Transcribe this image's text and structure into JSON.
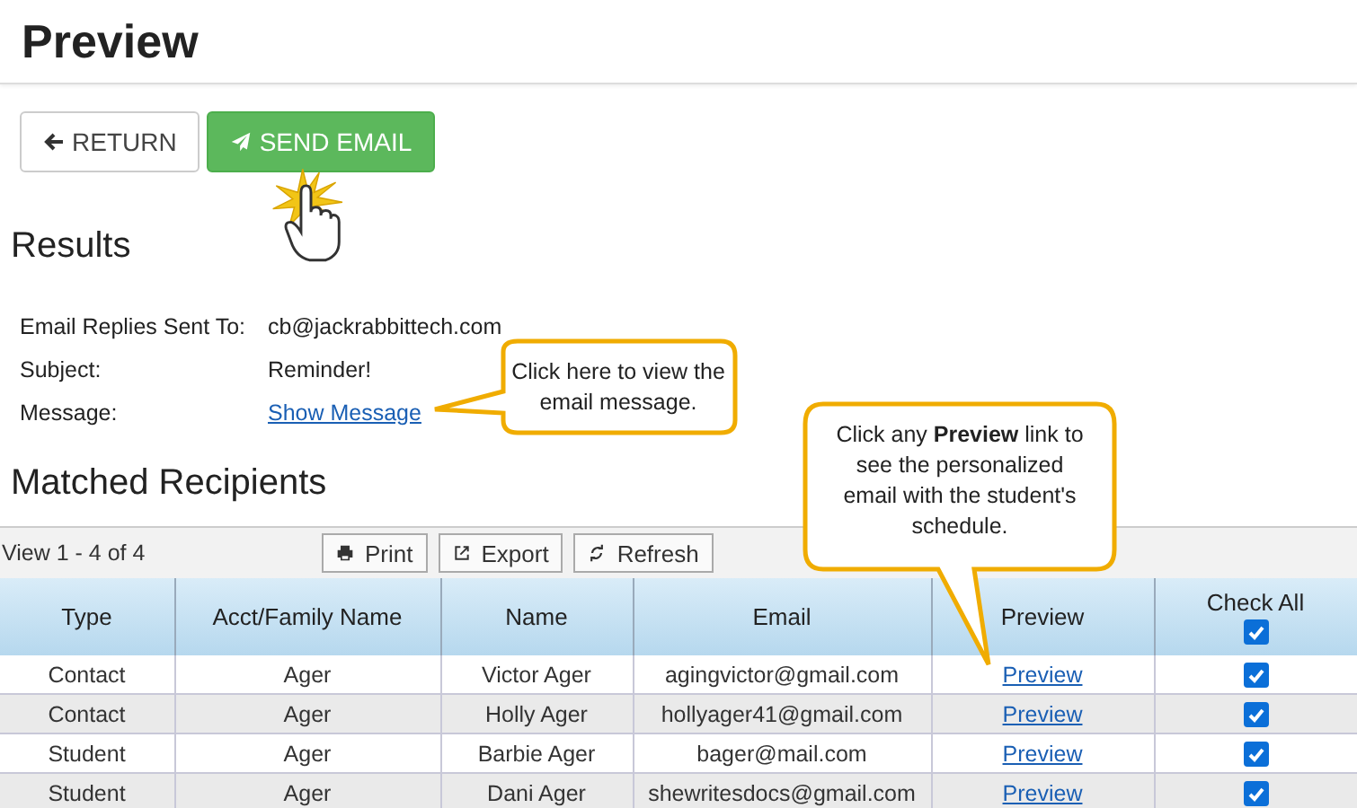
{
  "page_title": "Preview",
  "actions": [
    {
      "kind": "return",
      "label": "RETURN"
    },
    {
      "kind": "send",
      "label": "SEND EMAIL"
    }
  ],
  "results": {
    "heading": "Results",
    "fields": [
      {
        "label": "Email Replies Sent To:",
        "value": "cb@jackrabbittech.com",
        "kind": "text"
      },
      {
        "label": "Subject:",
        "value": "Reminder!",
        "kind": "text"
      },
      {
        "label": "Message:",
        "value": "Show Message",
        "kind": "link"
      }
    ]
  },
  "recipients": {
    "heading": "Matched Recipients",
    "view_text": "View 1 - 4 of 4",
    "tools": [
      {
        "kind": "print",
        "label": "Print"
      },
      {
        "kind": "export",
        "label": "Export"
      },
      {
        "kind": "refresh",
        "label": "Refresh"
      }
    ],
    "columns": [
      "Type",
      "Acct/Family Name",
      "Name",
      "Email",
      "Preview",
      "Check All"
    ],
    "check_all_checked": true,
    "rows": [
      {
        "type": "Contact",
        "family": "Ager",
        "name": "Victor Ager",
        "email": "agingvictor@gmail.com",
        "preview": "Preview",
        "checked": true
      },
      {
        "type": "Contact",
        "family": "Ager",
        "name": "Holly Ager",
        "email": "hollyager41@gmail.com",
        "preview": "Preview",
        "checked": true
      },
      {
        "type": "Student",
        "family": "Ager",
        "name": "Barbie Ager",
        "email": "bager@mail.com",
        "preview": "Preview",
        "checked": true
      },
      {
        "type": "Student",
        "family": "Ager",
        "name": "Dani Ager",
        "email": "shewritesdocs@gmail.com",
        "preview": "Preview",
        "checked": true
      }
    ]
  },
  "callouts": [
    {
      "kind": "left",
      "text": "Click here to view the email message."
    },
    {
      "kind": "down",
      "text": "Click any **Preview** link to see the personalized email with the student's schedule."
    }
  ]
}
